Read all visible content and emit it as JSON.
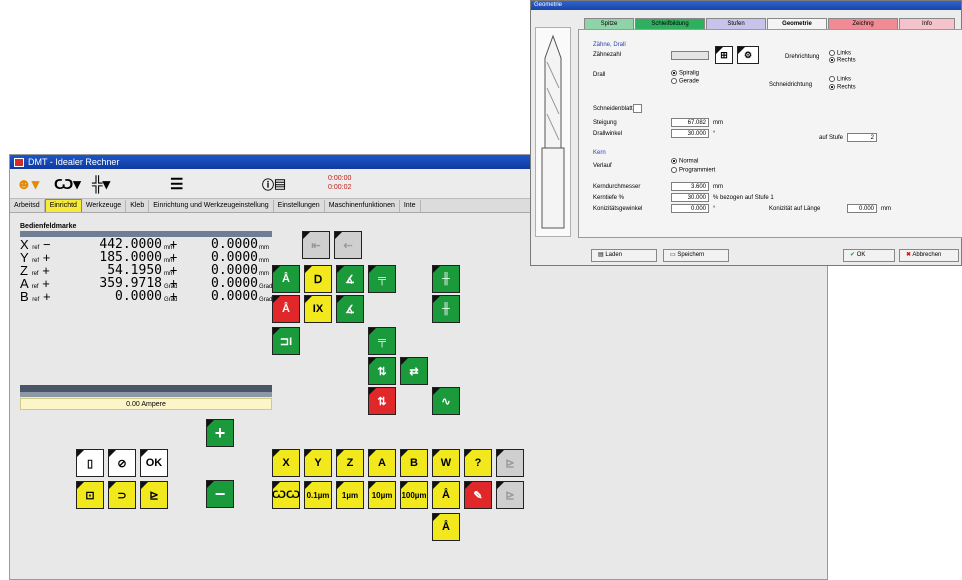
{
  "window": {
    "title": "DMT - Idealer Rechner"
  },
  "toolbar": {
    "times": [
      "0:00:00",
      "0:00:02"
    ]
  },
  "tabs": [
    "Arbeitsd",
    "Einrichtd",
    "Werkzeuge",
    "Kleb",
    "Einrichtung und Werkzeugeinstellung",
    "Einstellungen",
    "Maschinenfunktionen",
    "Inte"
  ],
  "positions": {
    "title": "Bedienfeldmarke",
    "rows": [
      {
        "axis": "X",
        "sub": "ref",
        "sign": "−",
        "value": "442.0000",
        "unit": "mm",
        "sign2": "+",
        "value2": "0.0000",
        "unit2": "mm"
      },
      {
        "axis": "Y",
        "sub": "ref",
        "sign": "+",
        "value": "185.0000",
        "unit": "mm",
        "sign2": "+",
        "value2": "0.0000",
        "unit2": "mm"
      },
      {
        "axis": "Z",
        "sub": "ref",
        "sign": "+",
        "value": "54.1950",
        "unit": "mm",
        "sign2": "+",
        "value2": "0.0000",
        "unit2": "mm"
      },
      {
        "axis": "A",
        "sub": "ref",
        "sign": "+",
        "value": "359.9718",
        "unit": "Grad",
        "sign2": "+",
        "value2": "0.0000",
        "unit2": "Grad"
      },
      {
        "axis": "B",
        "sub": "ref",
        "sign": "+",
        "value": "0.0000",
        "unit": "Grad",
        "sign2": "+",
        "value2": "0.0000",
        "unit2": "Grad"
      }
    ]
  },
  "override": {
    "value": "0.00 Ampere"
  },
  "buttons": {
    "ok": "OK",
    "plus": "+",
    "minus": "−",
    "axes": [
      "X",
      "Y",
      "Z",
      "A",
      "B",
      "W",
      "?"
    ],
    "steps": [
      "0.1µm",
      "1µm",
      "10µm",
      "100µm"
    ]
  },
  "dialog": {
    "title": "Geometrie",
    "tabs": [
      "Spitze",
      "Schleifbildung",
      "Stufen",
      "Geometrie",
      "Zeichng",
      "Info"
    ],
    "section1": "Zähne, Drall",
    "labels": {
      "zahnezahl": "Zähnezahl",
      "drall": "Drall",
      "drehrichtung": "Drehrichtung",
      "schneidrichtung": "Schneidrichtung",
      "schneidenbl": "Schneidenblatt",
      "steigung": "Steigung",
      "drallwinkel": "Drallwinkel",
      "auf_stufe": "auf Stufe",
      "kern": "Kern",
      "verlauf": "Verlauf",
      "kerndurch": "Kerndurchmesser",
      "kerntiefe": "Kerntiefe %",
      "konik": "Konizitätsgewinkel",
      "konik_lang": "Konizität auf Länge"
    },
    "options": {
      "spiral": "Spiralig",
      "gerade": "Gerade",
      "links": "Links",
      "rechts": "Rechts",
      "normal": "Normal",
      "prog": "Programmiert"
    },
    "values": {
      "steigung": "67.082",
      "steigung_unit": "mm",
      "drallwinkel": "30.000",
      "drallwinkel_unit": "°",
      "stufe": "2",
      "kerndurch": "3.600",
      "kerndurch_unit": "mm",
      "kerntiefe": "30.000",
      "kerntiefe_note": "% bezogen auf Stufe 1",
      "konik": "0.000",
      "konik_unit": "°",
      "konik_lang": "0.000",
      "konik_lang_unit": "mm"
    },
    "footer": {
      "laden": "Laden",
      "speichern": "Speichern",
      "ok": "OK",
      "abbrechen": "Abbrechen"
    }
  }
}
